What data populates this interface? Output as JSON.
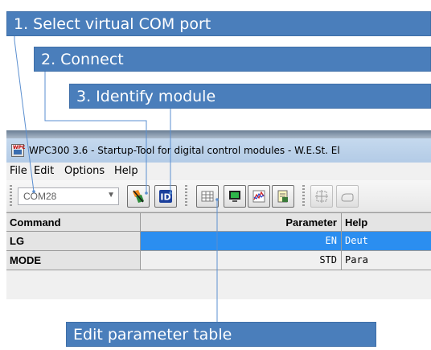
{
  "annotations": {
    "step1": "1. Select virtual COM port",
    "step2": "2. Connect",
    "step3": "3. Identify module",
    "edit_table": "Edit parameter table"
  },
  "window": {
    "title": "WPC300 3.6 - Startup-Tool for digital control modules  -  W.E.St. El",
    "icon_text": "WPC"
  },
  "menu": {
    "file": "File",
    "edit": "Edit",
    "options": "Options",
    "help": "Help"
  },
  "toolbar": {
    "com_port_value": "COM28",
    "connect_icon": "connect-plug-icon",
    "identify_label": "ID",
    "edit_table_icon": "table-icon",
    "monitor_icon": "monitor-icon",
    "scope_icon": "chart-icon",
    "document_icon": "document-icon",
    "selection_icon": "selection-icon",
    "open_icon": "open-icon"
  },
  "table": {
    "headers": {
      "command": "Command",
      "parameter": "Parameter",
      "help": "Help"
    },
    "rows": [
      {
        "command": "LG",
        "parameter": "EN",
        "help": "Deut"
      },
      {
        "command": "MODE",
        "parameter": "STD",
        "help": "Para"
      }
    ]
  },
  "colors": {
    "banner": "#4a7ebb",
    "selection": "#2b8ef0",
    "callout_line": "#5b8fd0"
  }
}
